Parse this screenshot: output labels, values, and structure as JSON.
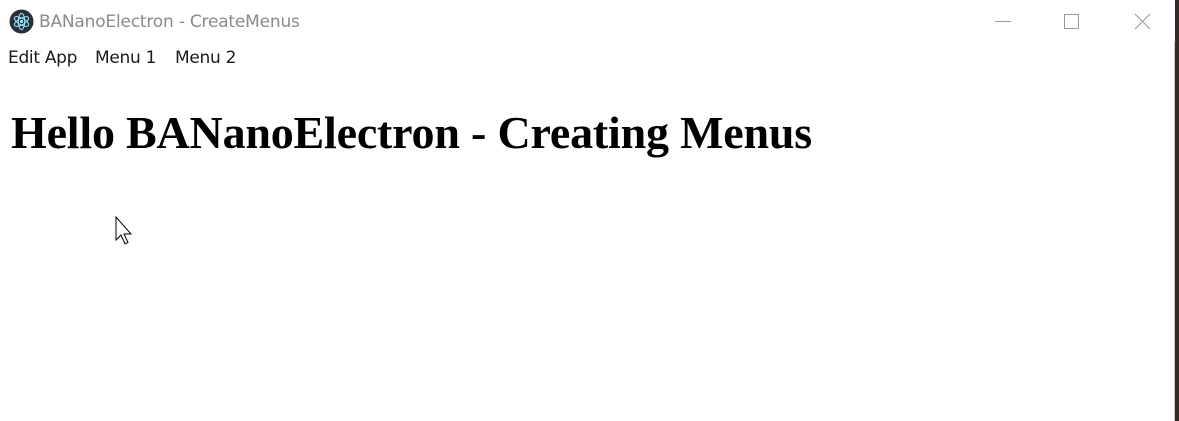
{
  "window": {
    "title": "BANanoElectron - CreateMenus",
    "icon": "electron-logo-icon",
    "controls": {
      "minimize": "minimize-icon",
      "maximize": "maximize-icon",
      "close": "close-icon"
    }
  },
  "menubar": {
    "items": [
      "Edit App",
      "Menu 1",
      "Menu 2"
    ]
  },
  "content": {
    "heading": "Hello BANanoElectron - Creating Menus"
  },
  "colors": {
    "title_text": "#8a8a8a",
    "menu_text": "#1a1a1a",
    "heading_text": "#000000",
    "background": "#ffffff"
  }
}
